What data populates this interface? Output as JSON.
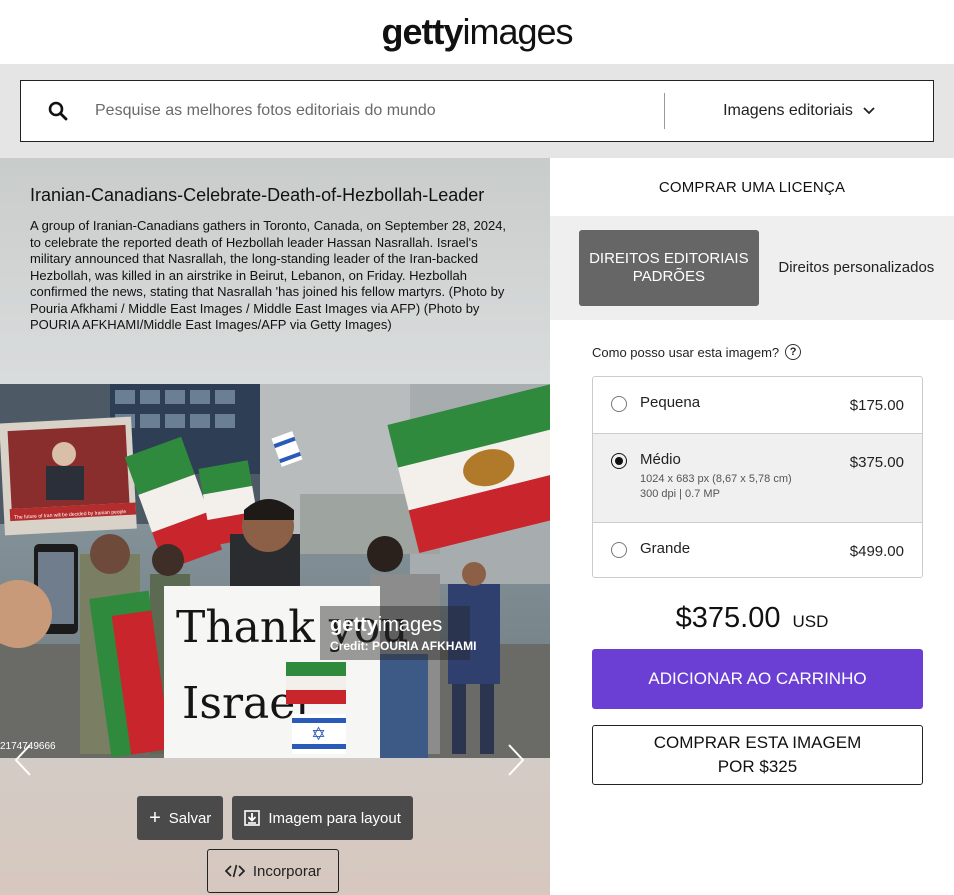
{
  "header": {
    "logo_bold": "getty",
    "logo_light": "images"
  },
  "search": {
    "placeholder": "Pesquise as melhores fotos editoriais do mundo",
    "filter_label": "Imagens editoriais"
  },
  "image": {
    "title": "Iranian-Canadians-Celebrate-Death-of-Hezbollah-Leader",
    "description": "A group of Iranian-Canadians gathers in Toronto, Canada, on September 28, 2024, to celebrate the reported death of Hezbollah leader Hassan Nasrallah. Israel's military announced that Nasrallah, the long-standing leader of the Iran-backed Hezbollah, was killed in an airstrike in Beirut, Lebanon, on Friday. Hezbollah confirmed the news, stating that Nasrallah 'has joined his fellow martyrs. (Photo by Pouria Afkhami / Middle East Images / Middle East Images via AFP) (Photo by POURIA AFKHAMI/Middle East Images/AFP via Getty Images)",
    "sign_line1": "Thank you",
    "sign_line2": "Israel",
    "watermark_bold": "getty",
    "watermark_light": "images",
    "credit": "Credit: POURIA AFKHAMI",
    "image_id": "2174749666",
    "poster_text": "The future of Iran will be decided by Iranian people"
  },
  "actions": {
    "save_label": "Salvar",
    "layout_label": "Imagem para layout",
    "embed_label": "Incorporar"
  },
  "license": {
    "title": "COMPRAR UMA LICENÇA",
    "tab_standard": "DIREITOS EDITORIAIS PADRÕES",
    "tab_custom": "Direitos personalizados",
    "usage_question": "Como posso usar esta imagem?",
    "options": [
      {
        "name": "Pequena",
        "price": "$175.00",
        "meta1": "",
        "meta2": "",
        "selected": false
      },
      {
        "name": "Médio",
        "price": "$375.00",
        "meta1": "1024 x 683 px (8,67 x 5,78 cm)",
        "meta2": "300 dpi | 0.7 MP",
        "selected": true
      },
      {
        "name": "Grande",
        "price": "$499.00",
        "meta1": "",
        "meta2": "",
        "selected": false
      }
    ],
    "total_price": "$375.00",
    "currency": "USD",
    "add_to_cart": "ADICIONAR AO CARRINHO",
    "buy_for": "COMPRAR ESTA IMAGEM POR $325"
  },
  "colors": {
    "accent": "#6b3fd4",
    "dark_button": "#4a4a4a",
    "active_tab": "#666666"
  }
}
